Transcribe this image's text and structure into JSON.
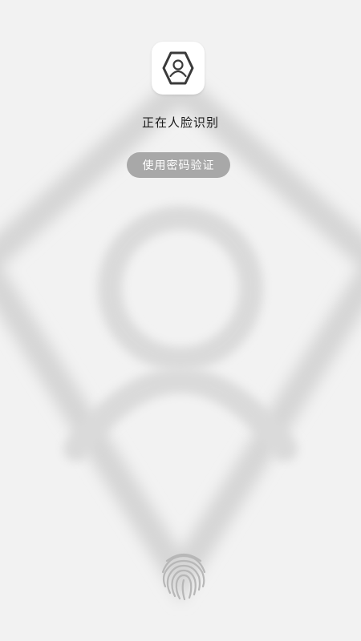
{
  "face_recognition": {
    "status_text": "正在人脸识别",
    "password_button_label": "使用密码验证"
  },
  "icons": {
    "app_icon": "user-hexagon-icon",
    "fingerprint": "fingerprint-icon",
    "background_silhouette": "person-silhouette"
  },
  "colors": {
    "background": "#f2f2f2",
    "button_bg": "#a8a8a8",
    "button_text": "#ffffff",
    "icon_stroke": "#3a3a3a"
  }
}
